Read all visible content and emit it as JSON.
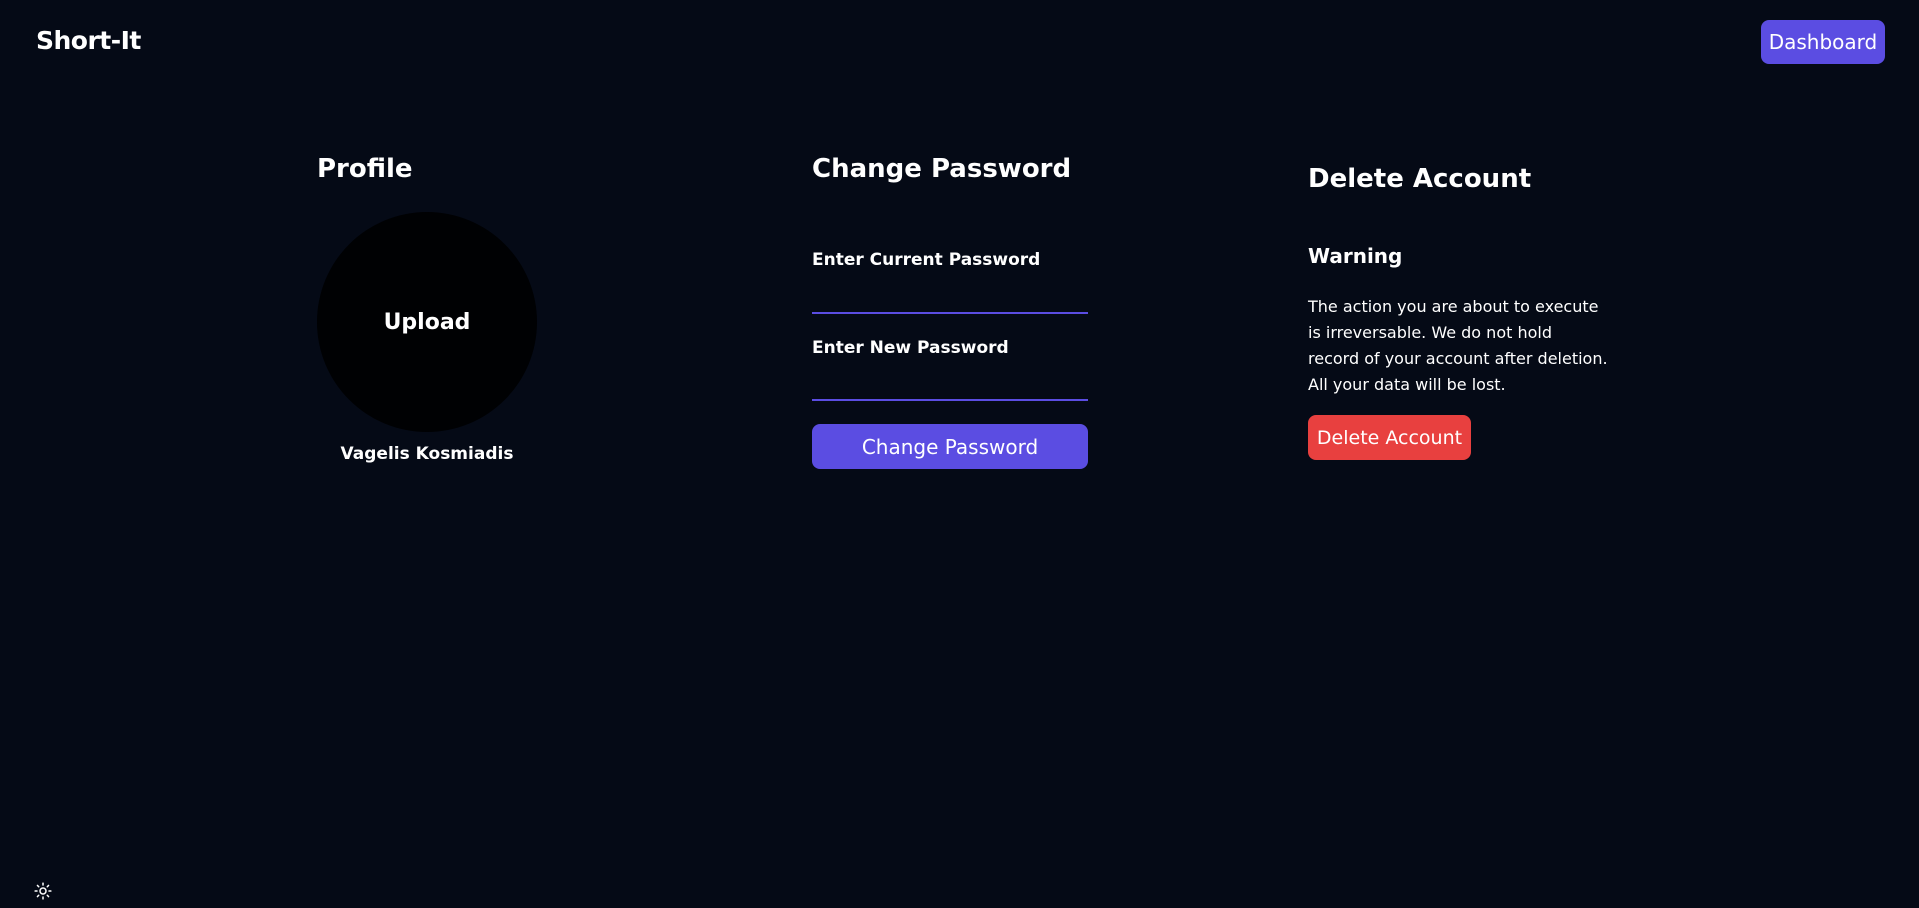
{
  "header": {
    "brand": "Short-It",
    "dashboard_label": "Dashboard"
  },
  "profile": {
    "title": "Profile",
    "upload_label": "Upload",
    "name": "Vagelis Kosmiadis"
  },
  "change_password": {
    "title": "Change Password",
    "current_label": "Enter Current Password",
    "current_value": "",
    "new_label": "Enter New Password",
    "new_value": "",
    "button_label": "Change Password"
  },
  "delete_account": {
    "title": "Delete Account",
    "warning_title": "Warning",
    "warning_text": "The action you are about to execute is irreversable. We do not hold record of your account after deletion. All your data will be lost.",
    "button_label": "Delete Account"
  },
  "footer": {
    "theme_icon": "sun-icon"
  },
  "colors": {
    "background": "#050a16",
    "accent": "#5b4de2",
    "danger": "#e8403f"
  }
}
